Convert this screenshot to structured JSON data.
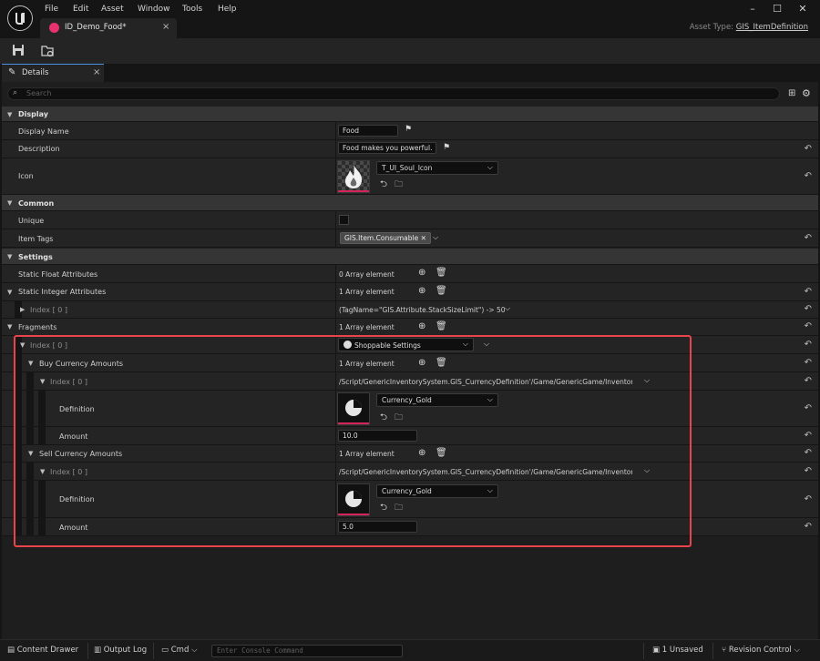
{
  "menu": [
    "File",
    "Edit",
    "Asset",
    "Window",
    "Tools",
    "Help"
  ],
  "window_controls": {
    "minimize": "–",
    "maximize": "☐",
    "close": "✕"
  },
  "doc_tab": {
    "title": "ID_Demo_Food*",
    "close": "×"
  },
  "asset_type": {
    "label": "Asset Type:",
    "value": "GIS_ItemDefinition"
  },
  "details_tab": {
    "title": "Details",
    "close": "×"
  },
  "search": {
    "placeholder": "Search"
  },
  "categories": {
    "display": "Display",
    "common": "Common",
    "settings": "Settings"
  },
  "display": {
    "display_name_label": "Display Name",
    "display_name_value": "Food",
    "description_label": "Description",
    "description_value": "Food makes you powerful.",
    "icon_label": "Icon",
    "icon_asset": "T_UI_Soul_Icon"
  },
  "common": {
    "unique_label": "Unique",
    "unique_checked": false,
    "item_tags_label": "Item Tags",
    "item_tag": "GIS.Item.Consumable"
  },
  "settings": {
    "static_float_label": "Static Float Attributes",
    "static_float_value": "0 Array element",
    "static_int_label": "Static Integer Attributes",
    "static_int_value": "1 Array element",
    "static_int_index_label": "Index [ 0 ]",
    "static_int_index_value": "(TagName=\"GIS.Attribute.StackSizeLimit\") -> 50",
    "fragments_label": "Fragments",
    "fragments_value": "1 Array element",
    "fragment_index_label": "Index [ 0 ]",
    "fragment_type": "Shoppable Settings",
    "buy_label": "Buy Currency Amounts",
    "buy_value": "1 Array element",
    "buy_index_label": "Index [ 0 ]",
    "buy_index_path": "/Script/GenericInventorySystem.GIS_CurrencyDefinition'/Game/GenericGame/InventorySys",
    "buy_definition_label": "Definition",
    "buy_definition_asset": "Currency_Gold",
    "buy_amount_label": "Amount",
    "buy_amount_value": "10.0",
    "sell_label": "Sell Currency Amounts",
    "sell_value": "1 Array element",
    "sell_index_label": "Index [ 0 ]",
    "sell_index_path": "/Script/GenericInventorySystem.GIS_CurrencyDefinition'/Game/GenericGame/InventorySys",
    "sell_definition_label": "Definition",
    "sell_definition_asset": "Currency_Gold",
    "sell_amount_label": "Amount",
    "sell_amount_value": "5.0"
  },
  "statusbar": {
    "content_drawer": "Content Drawer",
    "output_log": "Output Log",
    "cmd": "Cmd",
    "console_placeholder": "Enter Console Command",
    "unsaved": "1 Unsaved",
    "revision_control": "Revision Control"
  },
  "colors": {
    "accent": "#e8316f",
    "highlight_box": "#e9434b",
    "tab_underline": "#4a90e2"
  }
}
